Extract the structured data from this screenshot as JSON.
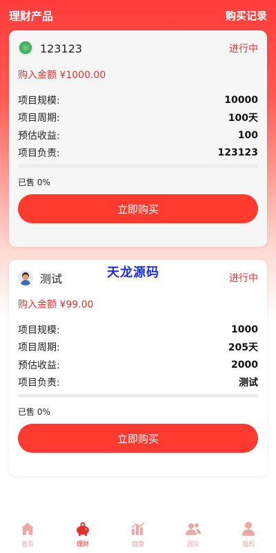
{
  "header": {
    "title": "理财产品",
    "records_label": "购买记录"
  },
  "products": [
    {
      "name": "123123",
      "status": "进行中",
      "price": "购入金额 ¥1000.00",
      "rows": [
        {
          "label": "项目规模:",
          "value": "10000"
        },
        {
          "label": "项目周期:",
          "value": "100天"
        },
        {
          "label": "预估收益:",
          "value": "100"
        },
        {
          "label": "项目负责:",
          "value": "123123"
        }
      ],
      "sold": "已售 0%",
      "progress": 0,
      "button": "立即购买",
      "avatar_icon": "green-landscape-avatar"
    },
    {
      "name": "测试",
      "status": "进行中",
      "price": "购入金额 ¥99.00",
      "rows": [
        {
          "label": "项目规模:",
          "value": "1000"
        },
        {
          "label": "项目周期:",
          "value": "205天"
        },
        {
          "label": "预估收益:",
          "value": "2000"
        },
        {
          "label": "项目负责:",
          "value": "测试"
        }
      ],
      "sold": "已售 0%",
      "progress": 0,
      "button": "立即购买",
      "avatar_icon": "person-avatar"
    }
  ],
  "watermark": "天龙源码",
  "tabbar": [
    {
      "label": "首页",
      "icon": "home-icon",
      "active": false
    },
    {
      "label": "理财",
      "icon": "piggy-bank-icon",
      "active": true
    },
    {
      "label": "健康",
      "icon": "chart-icon",
      "active": false
    },
    {
      "label": "团队",
      "icon": "team-icon",
      "active": false
    },
    {
      "label": "我的",
      "icon": "user-icon",
      "active": false
    }
  ],
  "colors": {
    "accent": "#ff3b30",
    "status": "#e5322d",
    "tab_inactive": "#f0a7a3"
  }
}
